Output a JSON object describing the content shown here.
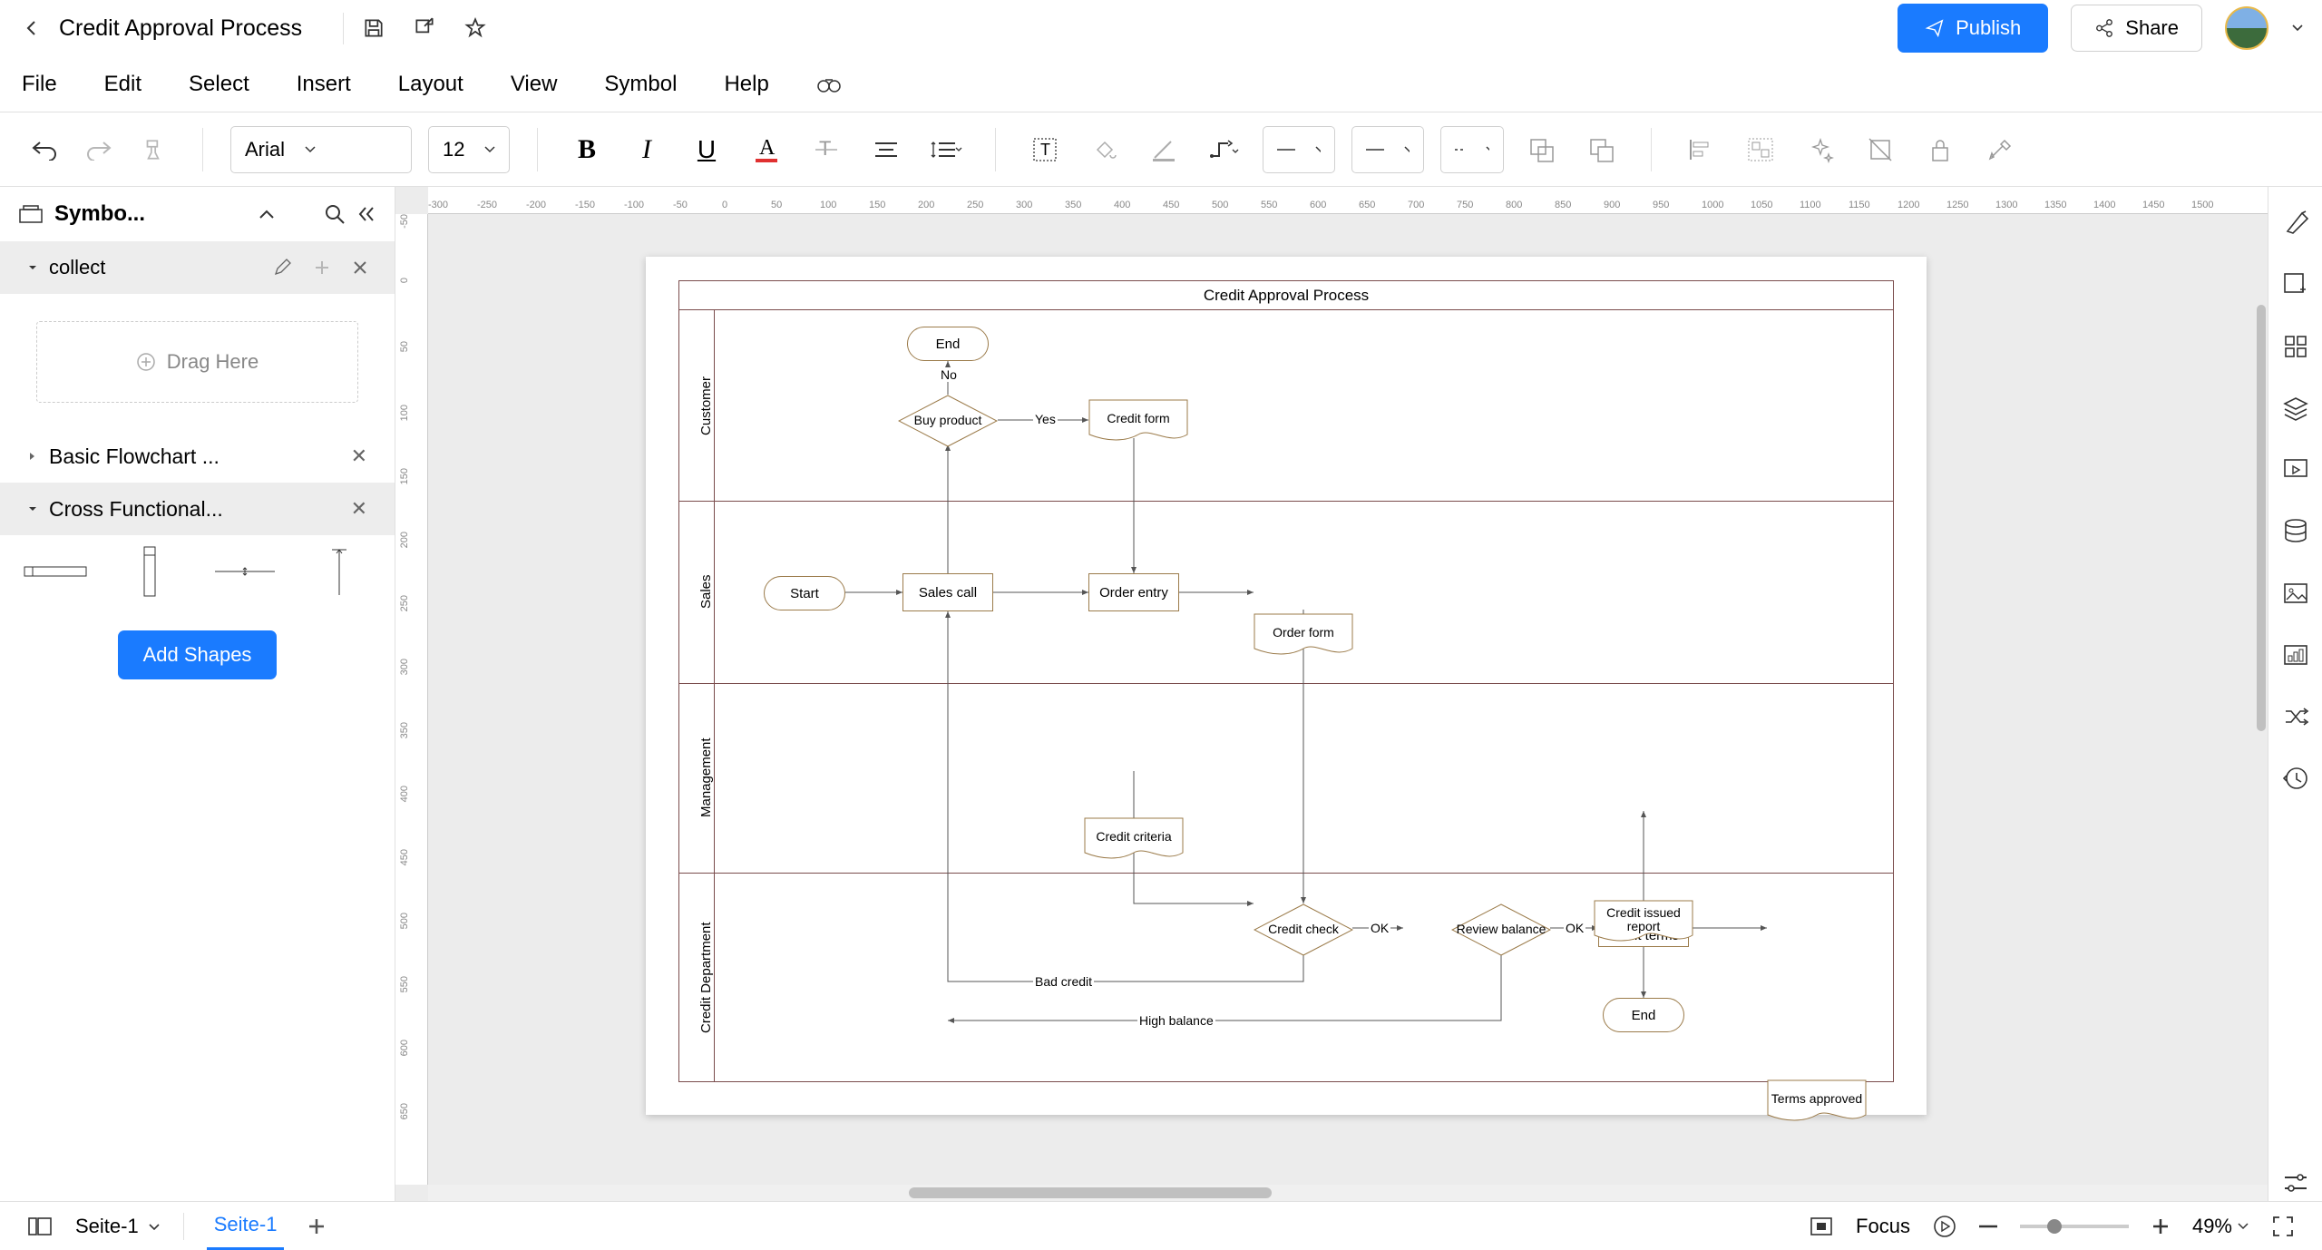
{
  "doc_name": "Credit Approval Process",
  "publish": "Publish",
  "share": "Share",
  "menu": [
    "File",
    "Edit",
    "Select",
    "Insert",
    "Layout",
    "View",
    "Symbol",
    "Help"
  ],
  "font_name": "Arial",
  "font_size": "12",
  "panel": {
    "title": "Symbo...",
    "collect": "collect",
    "drag_here": "Drag Here",
    "basic": "Basic Flowchart ...",
    "cross": "Cross Functional...",
    "add_shapes": "Add Shapes"
  },
  "status": {
    "page_name": "Seite-1",
    "page_tab": "Seite-1",
    "focus": "Focus",
    "zoom": "49%"
  },
  "diagram": {
    "title": "Credit Approval Process",
    "lanes": [
      "Customer",
      "Sales",
      "Management",
      "Credit Department"
    ],
    "nodes": {
      "start": "Start",
      "sales_call": "Sales call",
      "buy_product": "Buy product",
      "end1": "End",
      "credit_form": "Credit form",
      "order_entry": "Order entry",
      "order_form": "Order form",
      "credit_criteria": "Credit criteria",
      "credit_check": "Credit check",
      "review_balance": "Review balance",
      "calc_terms": "Calculate credit terms",
      "credit_issued": "Credit issued report",
      "terms_approved": "Terms approved",
      "end2": "End"
    },
    "edge_labels": {
      "yes": "Yes",
      "no": "No",
      "ok1": "OK",
      "ok2": "OK",
      "bad_credit": "Bad credit",
      "high_balance": "High balance"
    }
  },
  "ruler_h": [
    "-300",
    "-250",
    "-200",
    "-150",
    "-100",
    "-50",
    "0",
    "50",
    "100",
    "150",
    "200",
    "250",
    "300",
    "350",
    "400",
    "450",
    "500",
    "550",
    "600",
    "650",
    "700",
    "750",
    "800",
    "850",
    "900",
    "950",
    "1000",
    "1050",
    "1100",
    "1150",
    "1200",
    "1250",
    "1300",
    "1350",
    "1400",
    "1450",
    "1500"
  ],
  "ruler_v": [
    "-50",
    "0",
    "50",
    "100",
    "150",
    "200",
    "250",
    "300",
    "350",
    "400",
    "450",
    "500",
    "550",
    "600",
    "650"
  ],
  "chart_data": {
    "type": "swimlane-flowchart",
    "title": "Credit Approval Process",
    "lanes": [
      "Customer",
      "Sales",
      "Management",
      "Credit Department"
    ],
    "nodes": [
      {
        "id": "start",
        "label": "Start",
        "type": "terminator",
        "lane": "Sales"
      },
      {
        "id": "sales_call",
        "label": "Sales call",
        "type": "process",
        "lane": "Sales"
      },
      {
        "id": "buy_product",
        "label": "Buy product",
        "type": "decision",
        "lane": "Customer"
      },
      {
        "id": "end1",
        "label": "End",
        "type": "terminator",
        "lane": "Customer"
      },
      {
        "id": "credit_form",
        "label": "Credit form",
        "type": "document",
        "lane": "Customer"
      },
      {
        "id": "order_entry",
        "label": "Order entry",
        "type": "process",
        "lane": "Sales"
      },
      {
        "id": "order_form",
        "label": "Order form",
        "type": "document",
        "lane": "Sales"
      },
      {
        "id": "credit_criteria",
        "label": "Credit criteria",
        "type": "document",
        "lane": "Management"
      },
      {
        "id": "credit_check",
        "label": "Credit check",
        "type": "decision",
        "lane": "Credit Department"
      },
      {
        "id": "review_balance",
        "label": "Review balance",
        "type": "decision",
        "lane": "Credit Department"
      },
      {
        "id": "calc_terms",
        "label": "Calculate credit terms",
        "type": "process",
        "lane": "Credit Department"
      },
      {
        "id": "credit_issued",
        "label": "Credit issued report",
        "type": "document",
        "lane": "Management"
      },
      {
        "id": "terms_approved",
        "label": "Terms approved",
        "type": "document",
        "lane": "Credit Department"
      },
      {
        "id": "end2",
        "label": "End",
        "type": "terminator",
        "lane": "Credit Department"
      }
    ],
    "edges": [
      {
        "from": "start",
        "to": "sales_call"
      },
      {
        "from": "sales_call",
        "to": "buy_product"
      },
      {
        "from": "buy_product",
        "to": "end1",
        "label": "No"
      },
      {
        "from": "buy_product",
        "to": "credit_form",
        "label": "Yes"
      },
      {
        "from": "credit_form",
        "to": "order_entry"
      },
      {
        "from": "sales_call",
        "to": "order_entry"
      },
      {
        "from": "order_entry",
        "to": "order_form"
      },
      {
        "from": "order_form",
        "to": "credit_check"
      },
      {
        "from": "credit_criteria",
        "to": "credit_check"
      },
      {
        "from": "credit_check",
        "to": "review_balance",
        "label": "OK"
      },
      {
        "from": "credit_check",
        "to": "sales_call",
        "label": "Bad credit"
      },
      {
        "from": "review_balance",
        "to": "calc_terms",
        "label": "OK"
      },
      {
        "from": "review_balance",
        "to": "sales_call",
        "label": "High balance"
      },
      {
        "from": "calc_terms",
        "to": "credit_issued"
      },
      {
        "from": "calc_terms",
        "to": "terms_approved"
      },
      {
        "from": "calc_terms",
        "to": "end2"
      }
    ]
  }
}
